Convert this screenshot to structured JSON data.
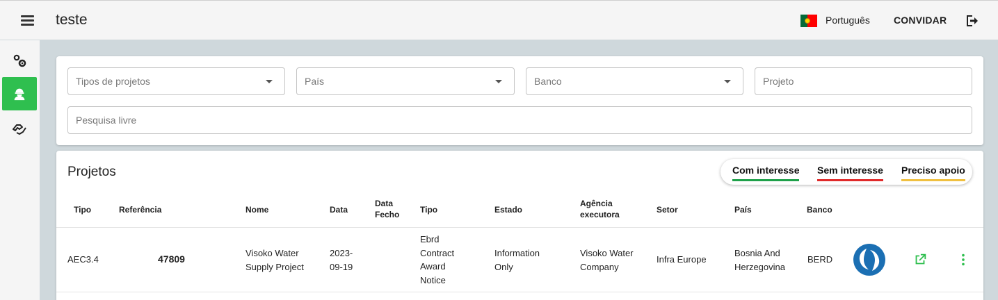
{
  "app": {
    "title": "teste"
  },
  "header": {
    "language": "Português",
    "invite_label": "CONVIDAR"
  },
  "colors": {
    "accent": "#2fbf4f",
    "interest": "#1fa14a",
    "no_interest": "#e02a2a",
    "need_support": "#f0c040"
  },
  "filters": {
    "project_types": "Tipos de projetos",
    "country": "País",
    "bank": "Banco",
    "project": "Projeto",
    "free_search": "Pesquisa livre"
  },
  "projects": {
    "title": "Projetos",
    "legend": {
      "interest": "Com interesse",
      "no_interest": "Sem interesse",
      "need_support": "Preciso apoio"
    },
    "columns": {
      "tipo": "Tipo",
      "referencia": "Referência",
      "nome": "Nome",
      "data": "Data",
      "data_fecho": "Data Fecho",
      "tipo2": "Tipo",
      "estado": "Estado",
      "agencia": "Agência executora",
      "setor": "Setor",
      "pais": "País",
      "banco": "Banco"
    },
    "rows": [
      {
        "tipo": "AEC3.4",
        "referencia": "47809",
        "nome": "Visoko Water Supply Project",
        "data": "2023-09-19",
        "data_fecho": "",
        "tipo2": "Ebrd Contract Award Notice",
        "estado": "Information Only",
        "agencia": "Visoko Water Company",
        "setor": "Infra Europe",
        "pais": "Bosnia And Herzegovina",
        "banco": "BERD"
      }
    ]
  }
}
